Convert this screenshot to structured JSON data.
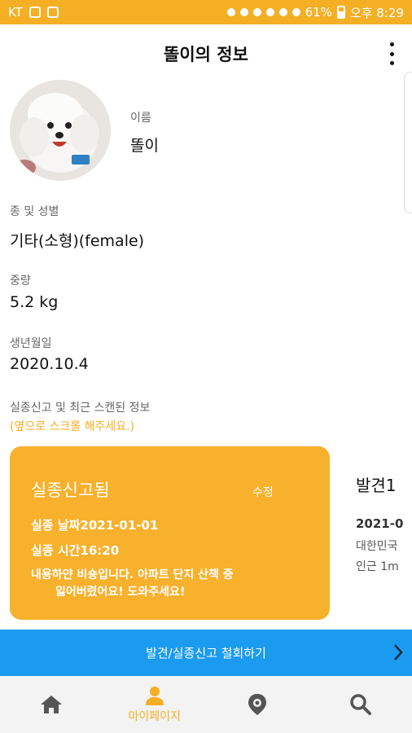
{
  "status_bar": {
    "carrier": "KT",
    "battery": "61%",
    "time": "오후 8:29"
  },
  "header": {
    "title": "똘이의 정보"
  },
  "profile": {
    "name_label": "이름",
    "name_value": "똘이",
    "species_label": "종 및 성별",
    "species_value": "기타(소형)(female)",
    "weight_label": "중량",
    "weight_value": "5.2 kg",
    "birth_label": "생년월일",
    "birth_value": "2020.10.4",
    "report_label": "실종신고 및 최근 스캔된 정보",
    "report_hint": "(옆으로 스크롤 해주세요.)"
  },
  "cards": {
    "missing": {
      "title": "실종신고됨",
      "edit": "수정",
      "date": "실종 날짜2021-01-01",
      "time": "실종 시간16:20",
      "desc1": "내용하얀 비숑입니다. 아파트 단지 산책 중",
      "desc2": "잃어버렸어요! 도와주세요!"
    },
    "found": {
      "title": "발견1",
      "date": "2021-0",
      "addr1": "대한민국",
      "addr2": "인근 1m"
    }
  },
  "action_bar": {
    "label": "발견/실종신고 철회하기"
  },
  "bottom_nav": {
    "mypage_label": "마이페이지"
  },
  "colors": {
    "accent": "#F4AF25",
    "card": "#F8B12C",
    "action": "#1B9BF0"
  }
}
